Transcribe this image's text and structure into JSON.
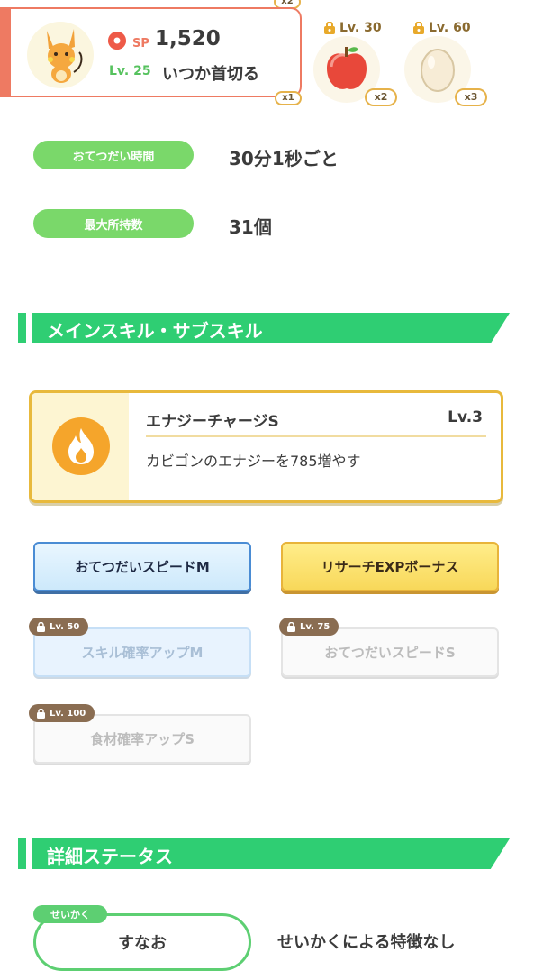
{
  "pokemon": {
    "sp_label": "SP",
    "sp_value": "1,520",
    "level": "Lv. 25",
    "nickname": "いつか首切る",
    "partial_badge_top": "x2",
    "partial_badge_bottom": "x1"
  },
  "ingredients": [
    {
      "unlock": "Lv. 30",
      "count": "x2",
      "icon": "apple-icon"
    },
    {
      "unlock": "Lv. 60",
      "count": "x3",
      "icon": "egg-icon"
    }
  ],
  "info": [
    {
      "label": "おてつだい時間",
      "value": "30分1秒ごと"
    },
    {
      "label": "最大所持数",
      "value": "31個"
    }
  ],
  "sections": {
    "skills": "メインスキル・サブスキル",
    "details": "詳細ステータス"
  },
  "main_skill": {
    "name": "エナジーチャージS",
    "level": "Lv.3",
    "description": "カビゴンのエナジーを785増やす",
    "icon": "fire-icon"
  },
  "sub_skills": [
    {
      "label": "おてつだいスピードM",
      "unlock": ""
    },
    {
      "label": "リサーチEXPボーナス",
      "unlock": ""
    },
    {
      "label": "スキル確率アップM",
      "unlock": "Lv. 50"
    },
    {
      "label": "おてつだいスピードS",
      "unlock": "Lv. 75"
    },
    {
      "label": "食材確率アップS",
      "unlock": "Lv. 100"
    }
  ],
  "nature": {
    "tag": "せいかく",
    "value": "すなお",
    "effect": "せいかくによる特徴なし"
  },
  "colors": {
    "green": "#2fce73",
    "coral": "#ee7a62",
    "gold": "#e8b93c",
    "blue": "#4a8cd4"
  }
}
